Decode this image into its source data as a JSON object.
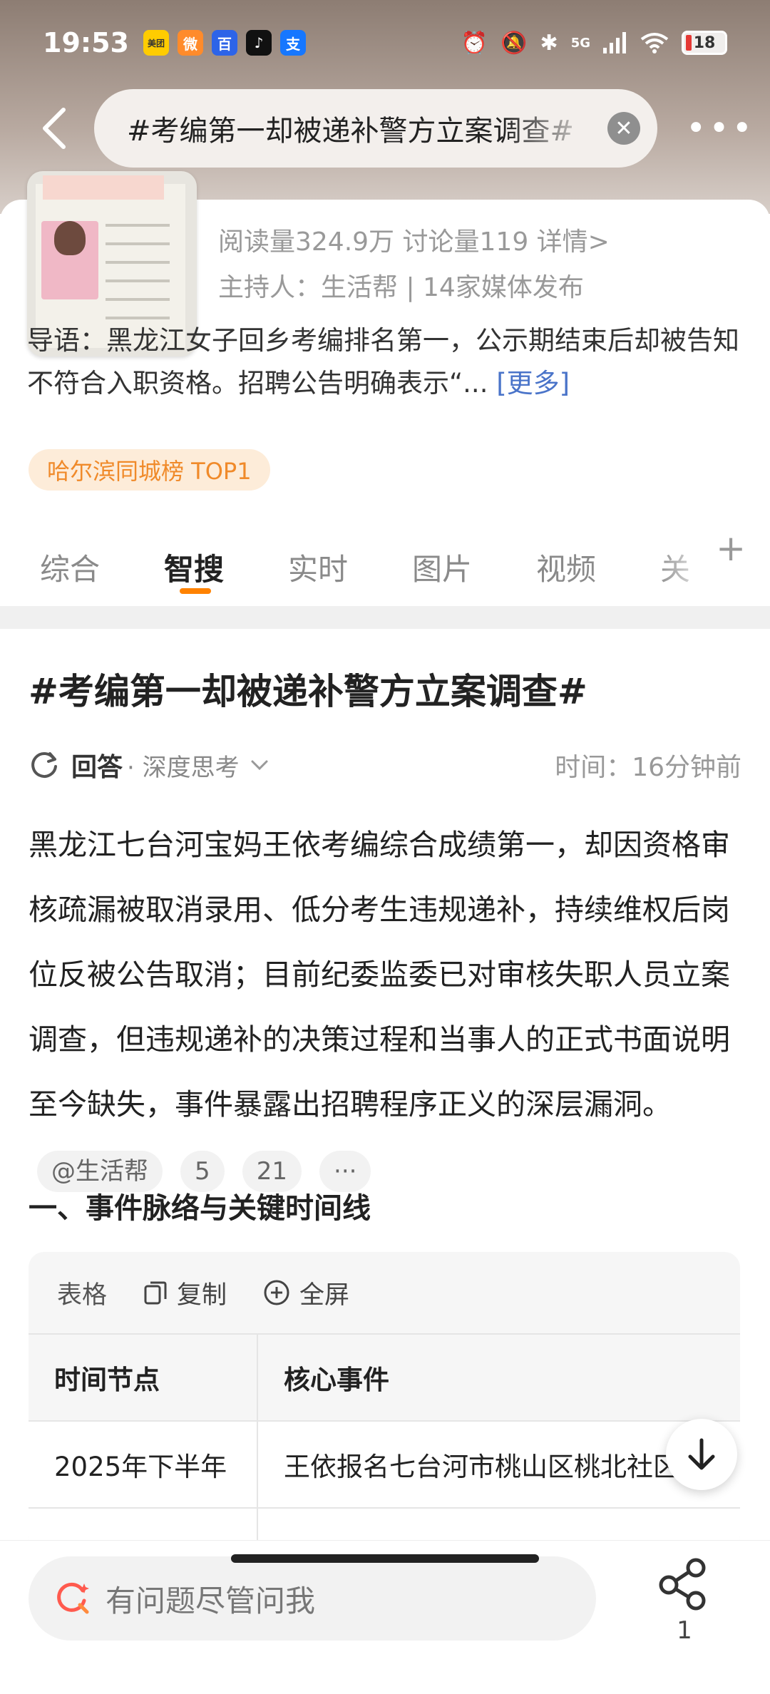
{
  "status": {
    "time": "19:53",
    "apps": [
      {
        "name": "meituan-icon",
        "label": "美团",
        "bg": "#ffcc00",
        "fg": "#333"
      },
      {
        "name": "weibo-icon",
        "label": "微",
        "bg": "#ff8b2b",
        "fg": "#fff"
      },
      {
        "name": "baidu-icon",
        "label": "百",
        "bg": "#2d64e8",
        "fg": "#fff"
      },
      {
        "name": "douyin-icon",
        "label": "♪",
        "bg": "#111111",
        "fg": "#fff"
      },
      {
        "name": "alipay-icon",
        "label": "支",
        "bg": "#1677ff",
        "fg": "#fff"
      }
    ],
    "signal": "5G",
    "battery": "18"
  },
  "search": {
    "query": "#考编第一却被递补警方立案调查#"
  },
  "topic": {
    "stats": "阅读量324.9万  讨论量119  详情>",
    "host": "主持人：生活帮 | 14家媒体发布",
    "intro": "导语：黑龙江女子回乡考编排名第一，公示期结束后却被告知不符合入职资格。招聘公告明确表示“...",
    "more": "[更多]",
    "rank_badge": "哈尔滨同城榜 TOP1"
  },
  "tabs": [
    {
      "label": "综合",
      "active": false
    },
    {
      "label": "智搜",
      "active": true
    },
    {
      "label": "实时",
      "active": false
    },
    {
      "label": "图片",
      "active": false
    },
    {
      "label": "视频",
      "active": false
    },
    {
      "label": "关",
      "active": false
    }
  ],
  "tab_plus": "+",
  "answer": {
    "title": "#考编第一却被递补警方立案调查#",
    "meta_label": "回答",
    "meta_mode": "· 深度思考",
    "time": "时间：16分钟前",
    "body": "黑龙江七台河宝妈王依考编综合成绩第一，却因资格审核疏漏被取消录用、低分考生违规递补，持续维权后岗位反被公告取消；目前纪委监委已对审核失职人员立案调查，但违规递补的决策过程和当事人的正式书面说明至今缺失，事件暴露出招聘程序正义的深层漏洞。",
    "chips": [
      "@生活帮",
      "5",
      "21",
      "···"
    ],
    "section_heading": "一、事件脉络与关键时间线"
  },
  "table": {
    "label": "表格",
    "copy": "复制",
    "fullscreen": "全屏",
    "headers": [
      "时间节点",
      "核心事件"
    ],
    "rows": [
      [
        "2025年下半年",
        "王依报名七台河市桃山区桃北社区"
      ]
    ]
  },
  "bottom": {
    "ask_placeholder": "有问题尽管问我",
    "share_count": "1"
  }
}
